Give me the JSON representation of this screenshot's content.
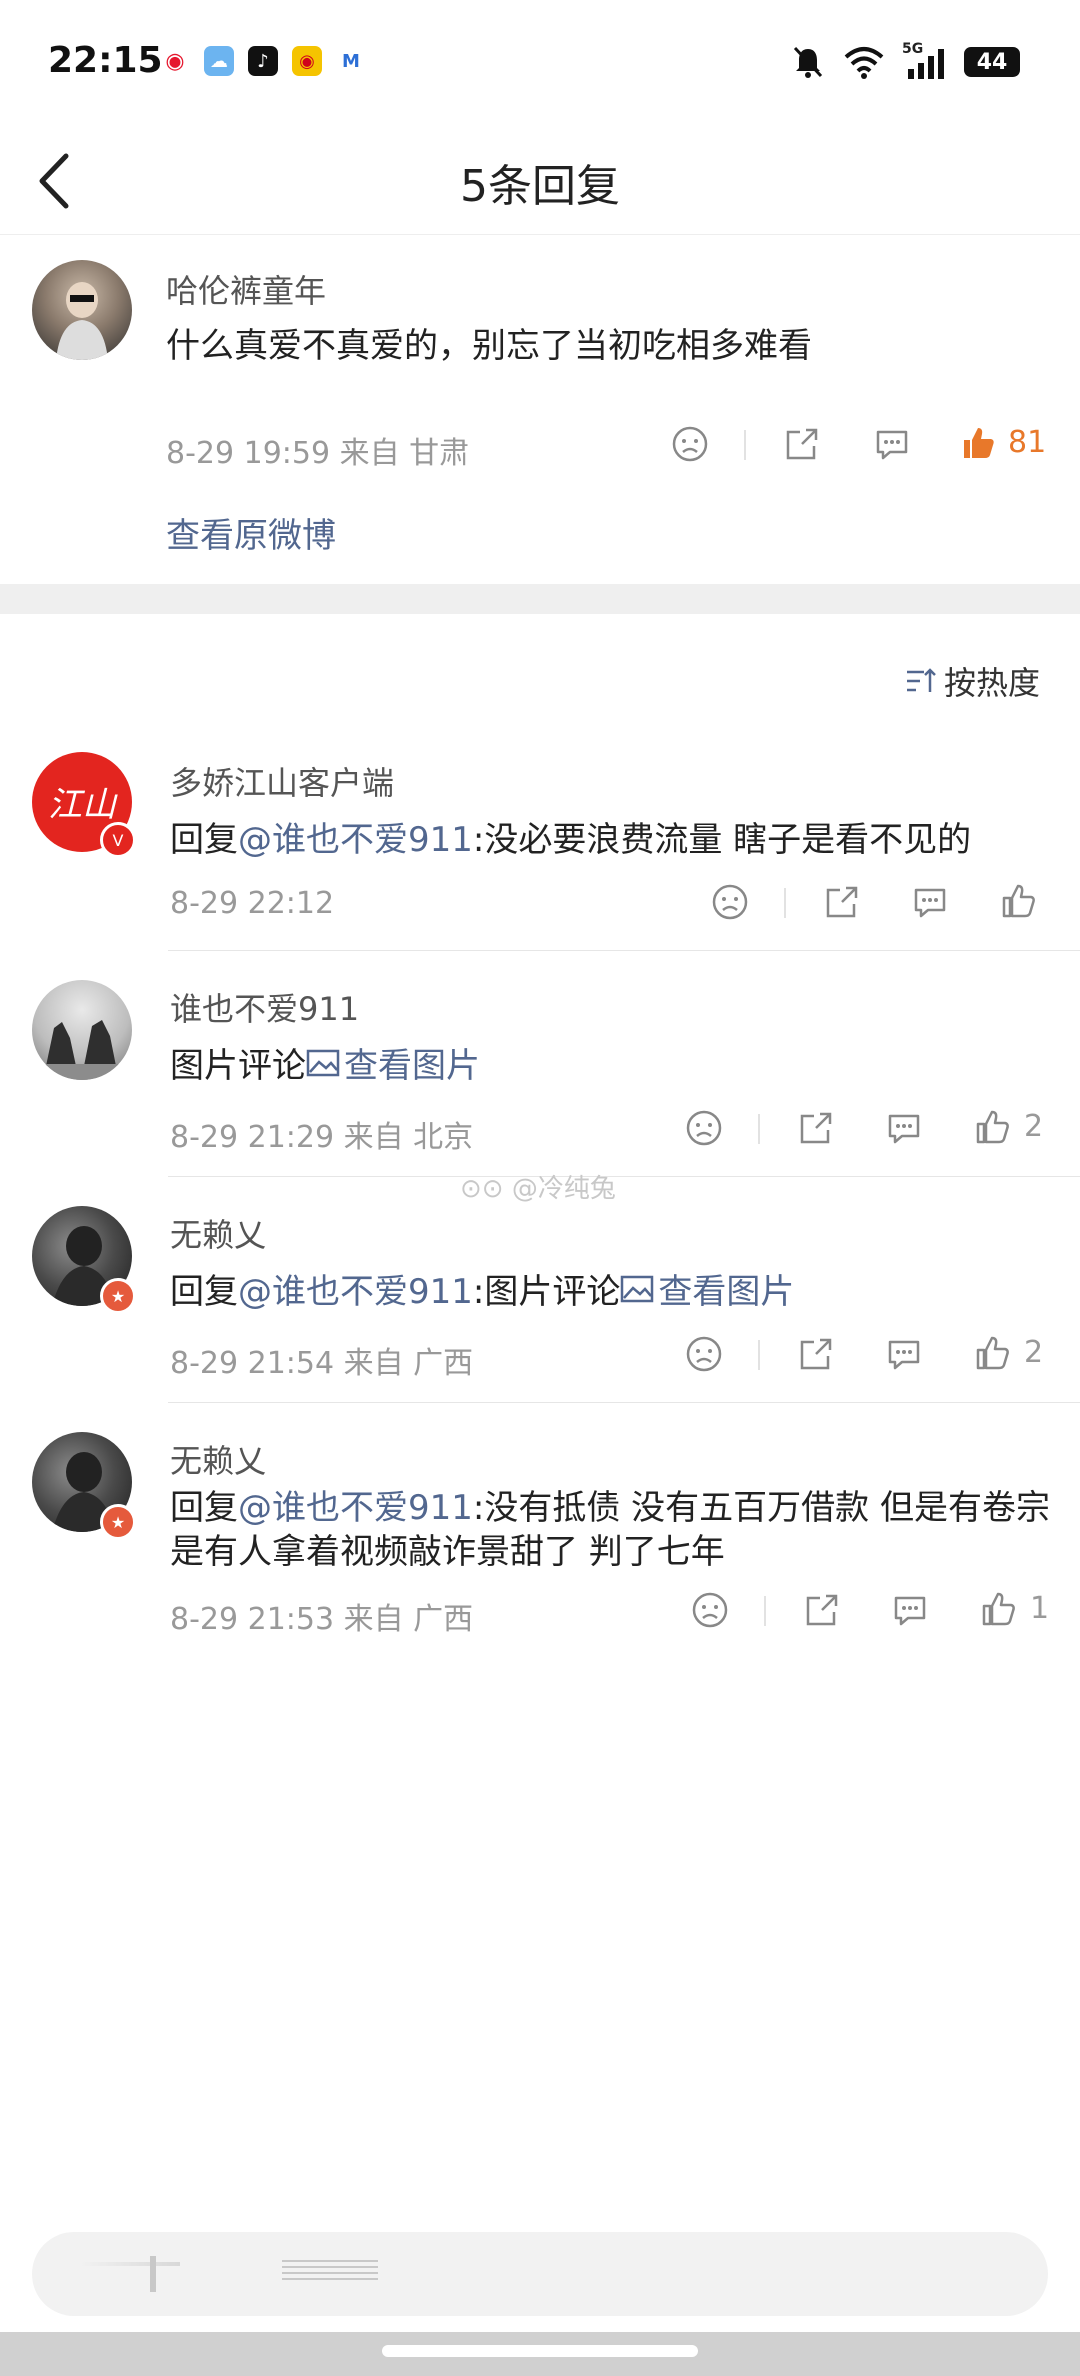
{
  "status": {
    "time": "22:15",
    "battery": "44",
    "network": "5G"
  },
  "header": {
    "title": "5条回复"
  },
  "root": {
    "username": "哈伦裤童年",
    "text": "什么真爱不真爱的，别忘了当初吃相多难看",
    "meta": "8-29 19:59  来自 甘肃",
    "likes": "81",
    "view_original": "查看原微博"
  },
  "sort_label": "按热度",
  "replies": [
    {
      "username": "多娇江山客户端",
      "prefix": "回复",
      "mention": "@谁也不爱911",
      "text": ":没必要浪费流量 瞎子是看不见的",
      "link": "",
      "meta": "8-29 22:12",
      "likes": ""
    },
    {
      "username": "谁也不爱911",
      "prefix": "图片评论 ",
      "mention": "",
      "text": "",
      "link": "查看图片",
      "meta": "8-29 21:29  来自 北京",
      "likes": "2"
    },
    {
      "username": "无赖乂",
      "prefix": "回复",
      "mention": "@谁也不爱911",
      "text": ":图片评论 ",
      "link": "查看图片",
      "meta": "8-29 21:54  来自 广西",
      "likes": "2"
    },
    {
      "username": "无赖乂",
      "prefix": "回复",
      "mention": "@谁也不爱911",
      "text": ":没有抵债 没有五百万借款 但是有卷宗是有人拿着视频敲诈景甜了 判了七年",
      "link": "",
      "meta": "8-29 21:53  来自 广西",
      "likes": "1"
    }
  ],
  "watermark": "@冷纯兔",
  "colors": {
    "accent_link": "#52678f",
    "like_active": "#e8782a",
    "separator": "#efefef"
  }
}
